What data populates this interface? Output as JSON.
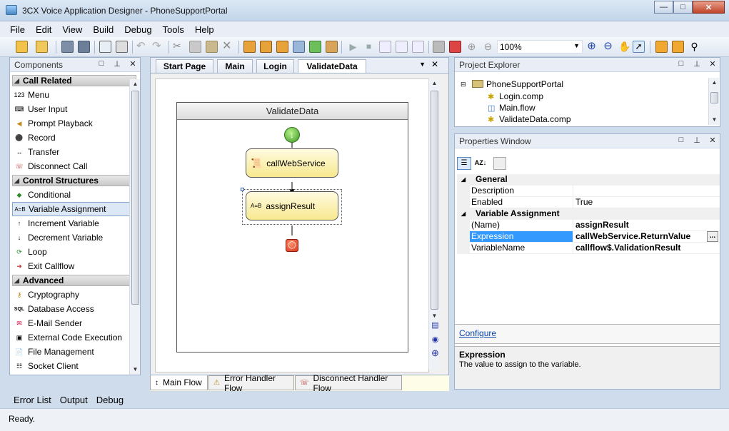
{
  "window": {
    "title": "3CX Voice Application Designer - PhoneSupportPortal"
  },
  "menu": [
    "File",
    "Edit",
    "View",
    "Build",
    "Debug",
    "Tools",
    "Help"
  ],
  "toolbar": {
    "zoom": "100%"
  },
  "components": {
    "title": "Components",
    "categories": [
      {
        "label": "Call Related",
        "items": [
          "Menu",
          "User Input",
          "Prompt Playback",
          "Record",
          "Transfer",
          "Disconnect Call"
        ]
      },
      {
        "label": "Control Structures",
        "items": [
          "Conditional",
          "Variable Assignment",
          "Increment Variable",
          "Decrement Variable",
          "Loop",
          "Exit Callflow"
        ]
      },
      {
        "label": "Advanced",
        "items": [
          "Cryptography",
          "Database Access",
          "E-Mail Sender",
          "External Code Execution",
          "File Management",
          "Socket Client"
        ]
      }
    ],
    "selected": "Variable Assignment"
  },
  "doc_tabs": [
    "Start Page",
    "Main",
    "Login",
    "ValidateData"
  ],
  "active_doc_tab": "ValidateData",
  "flow": {
    "title": "ValidateData",
    "nodes": [
      {
        "label": "callWebService",
        "icon": "script-icon"
      },
      {
        "label": "assignResult",
        "icon_text": "A=B"
      }
    ]
  },
  "flow_tabs": [
    "Main Flow",
    "Error Handler Flow",
    "Disconnect Handler Flow"
  ],
  "project_explorer": {
    "title": "Project Explorer",
    "root": "PhoneSupportPortal",
    "children": [
      "Login.comp",
      "Main.flow",
      "ValidateData.comp"
    ]
  },
  "properties": {
    "title": "Properties Window",
    "groups": [
      {
        "name": "General",
        "rows": [
          {
            "key": "Description",
            "value": ""
          },
          {
            "key": "Enabled",
            "value": "True"
          }
        ]
      },
      {
        "name": "Variable Assignment",
        "rows": [
          {
            "key": "(Name)",
            "value": "assignResult"
          },
          {
            "key": "Expression",
            "value": "callWebService.ReturnValue"
          },
          {
            "key": "VariableName",
            "value": "callflow$.ValidationResult"
          }
        ]
      }
    ],
    "link": "Configure",
    "help_title": "Expression",
    "help_text": "The value to assign to the variable."
  },
  "bottom_tabs": [
    "Error List",
    "Output",
    "Debug"
  ],
  "status": "Ready.",
  "colors": {
    "node_fill": "#f7e88f",
    "selection": "#3399ff",
    "start": "#5bb33a",
    "end": "#d9361f"
  }
}
